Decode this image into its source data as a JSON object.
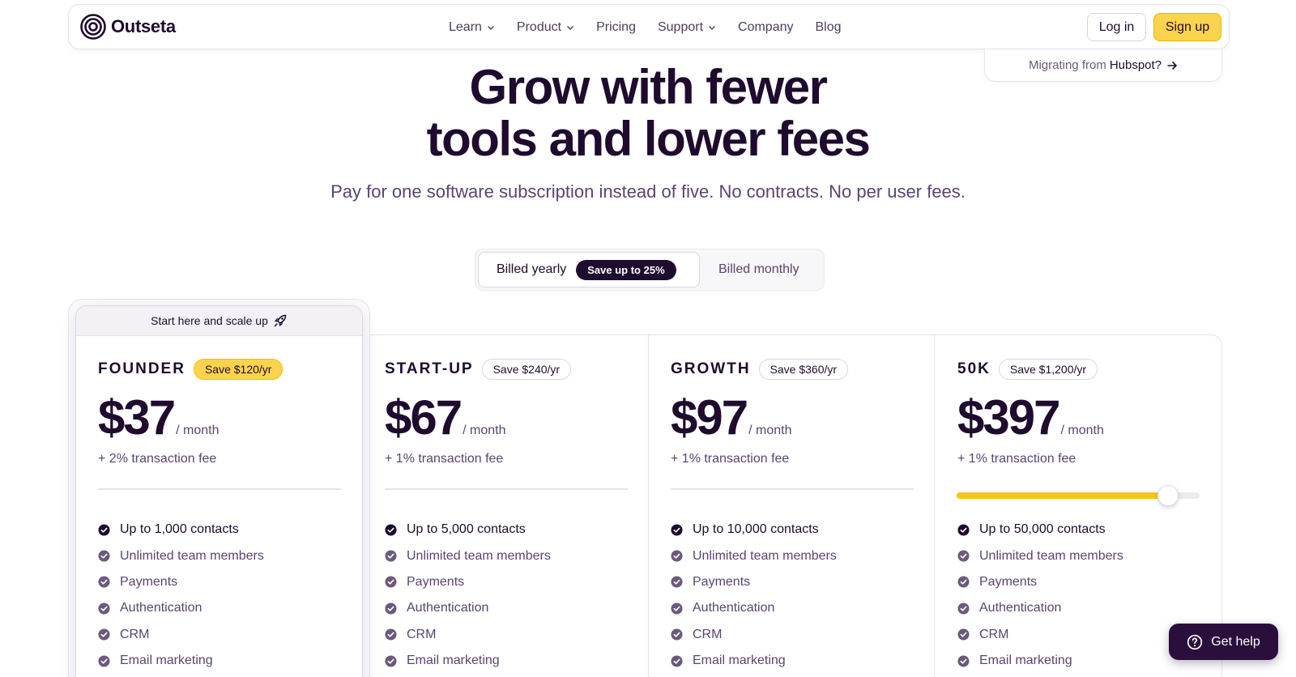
{
  "nav": {
    "brand": "Outseta",
    "menu": [
      {
        "label": "Learn",
        "has_dropdown": true
      },
      {
        "label": "Product",
        "has_dropdown": true
      },
      {
        "label": "Pricing",
        "has_dropdown": false
      },
      {
        "label": "Support",
        "has_dropdown": true
      },
      {
        "label": "Company",
        "has_dropdown": false
      },
      {
        "label": "Blog",
        "has_dropdown": false
      }
    ],
    "login_label": "Log in",
    "signup_label": "Sign up"
  },
  "migrate": {
    "prefix": "Migrating from",
    "highlight": "Hubspot?"
  },
  "hero": {
    "title_line1": "Grow with fewer",
    "title_line2": "tools and lower fees",
    "subtitle": "Pay for one software subscription instead of five. No contracts. No per user fees."
  },
  "billing": {
    "yearly_label": "Billed yearly",
    "save_badge": "Save up to 25%",
    "monthly_label": "Billed monthly",
    "selected": "yearly"
  },
  "founder_banner": "Start here and scale up",
  "plans": [
    {
      "name": "FOUNDER",
      "save": "Save $120/yr",
      "price": "$37",
      "per": "/ month",
      "fee": "+ 2% transaction fee",
      "features": [
        "Up to 1,000 contacts",
        "Unlimited team members",
        "Payments",
        "Authentication",
        "CRM",
        "Email marketing"
      ]
    },
    {
      "name": "START-UP",
      "save": "Save $240/yr",
      "price": "$67",
      "per": "/ month",
      "fee": "+ 1% transaction fee",
      "features": [
        "Up to 5,000 contacts",
        "Unlimited team members",
        "Payments",
        "Authentication",
        "CRM",
        "Email marketing"
      ]
    },
    {
      "name": "GROWTH",
      "save": "Save $360/yr",
      "price": "$97",
      "per": "/ month",
      "fee": "+ 1% transaction fee",
      "features": [
        "Up to 10,000 contacts",
        "Unlimited team members",
        "Payments",
        "Authentication",
        "CRM",
        "Email marketing"
      ]
    },
    {
      "name": "50K",
      "save": "Save $1,200/yr",
      "price": "$397",
      "per": "/ month",
      "fee": "+ 1% transaction fee",
      "features": [
        "Up to 50,000 contacts",
        "Unlimited team members",
        "Payments",
        "Authentication",
        "CRM",
        "Email marketing"
      ]
    }
  ],
  "contacts_slider": {
    "level_percent": 87
  },
  "help": {
    "label": "Get help"
  },
  "colors": {
    "ink": "#1e0b2e",
    "muted": "#5a4570",
    "accent_yellow": "#fcd34d",
    "slider_fill": "#f5c518",
    "help_bg": "#2a0f3d"
  },
  "icons": [
    "outseta-logo-icon",
    "chevron-down-icon",
    "arrow-right-icon",
    "rocket-icon",
    "check-circle-icon",
    "question-circle-icon"
  ]
}
